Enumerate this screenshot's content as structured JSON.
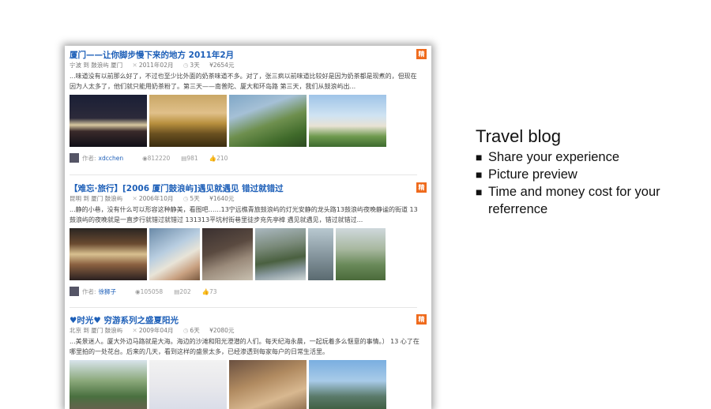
{
  "hot_label": "精",
  "entries": [
    {
      "title": "厦门——让你脚步慢下来的地方 2011年2月",
      "route": "宁波 到 鼓浪屿 厦门",
      "date": "2011年02月",
      "days": "3天",
      "cost": "¥2654元",
      "excerpt": "...味道没有以前那么好了，不过也至少比外面的奶茶味道不多。对了，张三疯以前味道比较好是因为奶茶都是现煮的，但现在因为人太多了，他们就只能用奶茶粉了。第三天——南普陀、厦大和环岛路 第三天，我们从鼓浪屿出...",
      "author": "xdcchen",
      "views": "812220",
      "comments": "981",
      "likes": "210"
    },
    {
      "title": "【难忘·旅行】[2006 厦门鼓浪屿]遇见就遇见 错过就错过",
      "route": "昆明 到 厦门 鼓浪屿",
      "date": "2006年10月",
      "days": "5天",
      "cost": "¥1640元",
      "excerpt": "...静的小巷，没有什么可以形容这种静美，看图吧……13宁远樵青旅鼓浪屿的灯光安静的龙头路13鼓浪屿夜晚静谧的街道 13鼓浪屿的夜晚就是一直步行就错过就错过 131313平坑村街巷里徒步充先亭樟 遇见就遇见，错过就错过...",
      "author": "徐狮子",
      "views": "105058",
      "comments": "202",
      "likes": "73"
    },
    {
      "title": "♥时光♥ 穷游系列之盛夏阳光",
      "route": "北京 到 厦门 鼓浪屿",
      "date": "2009年04月",
      "days": "6天",
      "cost": "¥2080元",
      "excerpt": "...美景迷人。厦大外边马路就是大海。海边的沙滩和阳光澄潜的人们。每天纪海永晨，一起玩着多么惬意的事情。） 13 心了在哪里拍的一处花台。后来的几天，看到这样的盛景太多，已经渗透到每家每户的日常生活里。"
    }
  ],
  "annotation": {
    "heading": "Travel blog",
    "items": [
      "Share your experience",
      "Picture preview",
      "Time and money cost for your referrence"
    ],
    "bullet": "■"
  }
}
